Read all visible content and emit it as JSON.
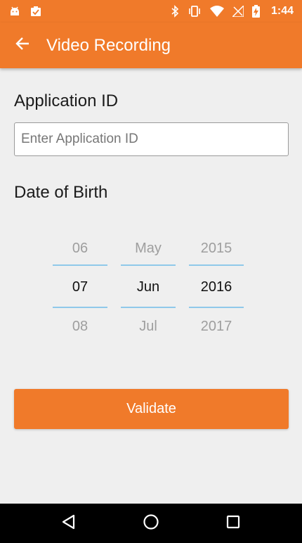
{
  "status_bar": {
    "time": "1:44"
  },
  "app_bar": {
    "title": "Video Recording"
  },
  "form": {
    "app_id_label": "Application ID",
    "app_id_placeholder": "Enter Application ID",
    "app_id_value": "",
    "dob_label": "Date of Birth"
  },
  "date_picker": {
    "day": {
      "prev": "06",
      "selected": "07",
      "next": "08"
    },
    "month": {
      "prev": "May",
      "selected": "Jun",
      "next": "Jul"
    },
    "year": {
      "prev": "2015",
      "selected": "2016",
      "next": "2017"
    }
  },
  "actions": {
    "validate_label": "Validate"
  },
  "colors": {
    "accent": "#f07a2a",
    "picker_divider": "#8fc9ea",
    "background": "#efefef"
  },
  "icons": {
    "status_left": [
      "android-debug-icon",
      "clipboard-check-icon"
    ],
    "status_right": [
      "bluetooth-icon",
      "vibrate-icon",
      "wifi-icon",
      "signal-icon",
      "battery-charging-icon"
    ],
    "app_bar": [
      "back-arrow-icon"
    ],
    "nav": [
      "back-triangle-icon",
      "home-circle-icon",
      "recents-square-icon"
    ]
  }
}
